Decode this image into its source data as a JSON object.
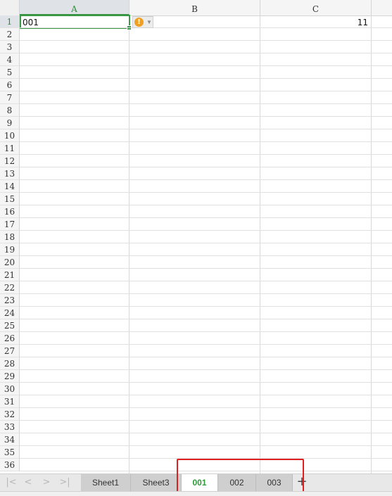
{
  "columns": [
    "A",
    "B",
    "C"
  ],
  "active_column": "A",
  "active_row": 1,
  "rows": [
    "1",
    "2",
    "3",
    "4",
    "5",
    "6",
    "7",
    "8",
    "9",
    "10",
    "11",
    "12",
    "13",
    "14",
    "15",
    "16",
    "17",
    "18",
    "19",
    "20",
    "21",
    "22",
    "23",
    "24",
    "25",
    "26",
    "27",
    "28",
    "29",
    "30",
    "31",
    "32",
    "33",
    "34",
    "35",
    "36"
  ],
  "cells": {
    "A1": "001",
    "C1": "11"
  },
  "warning_icon": "exclamation-warning-icon",
  "sheet_tabs": [
    {
      "label": "Sheet1",
      "active": false
    },
    {
      "label": "Sheet3",
      "active": false
    },
    {
      "label": "001",
      "active": true
    },
    {
      "label": "002",
      "active": false
    },
    {
      "label": "003",
      "active": false
    }
  ],
  "nav_buttons": [
    "first-sheet-icon",
    "prev-sheet-icon",
    "next-sheet-icon",
    "last-sheet-icon"
  ],
  "colors": {
    "accent_green": "#3b9a45",
    "highlight_red": "#e02020",
    "warning_orange": "#f0a020"
  }
}
